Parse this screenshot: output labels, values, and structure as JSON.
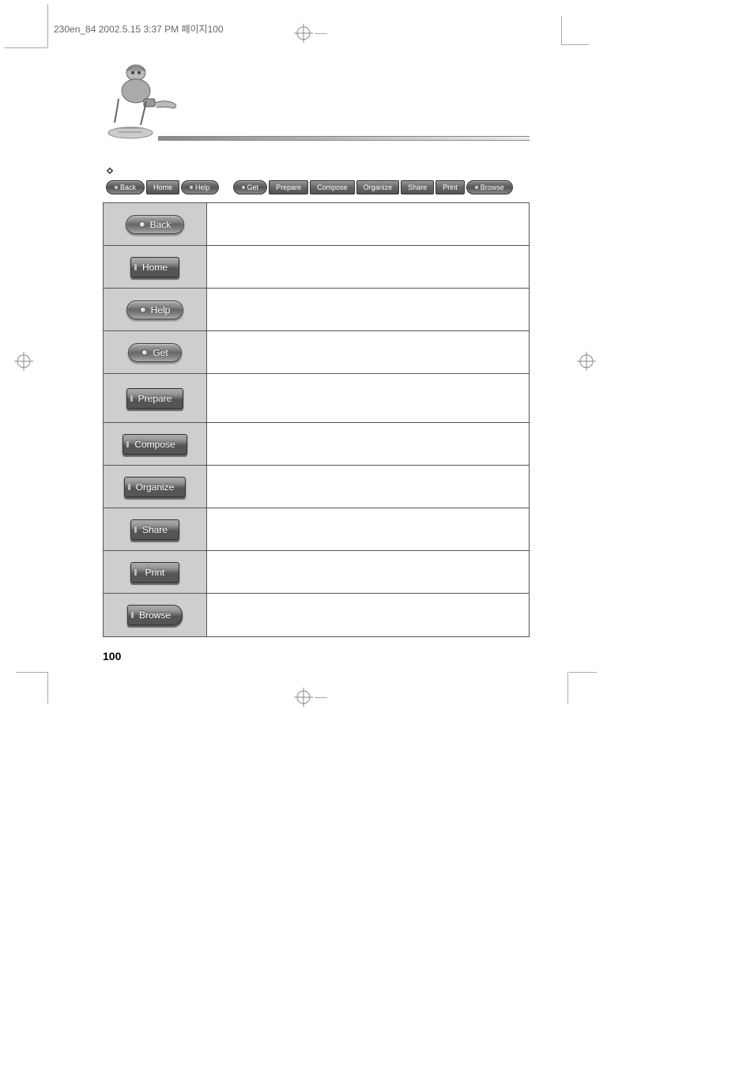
{
  "document": {
    "header_text": "230en_84  2002.5.15 3:37 PM  페이지100",
    "page_number": "100"
  },
  "toolbar": {
    "items": [
      "Back",
      "Home",
      "Help",
      "Get",
      "Prepare",
      "Compose",
      "Organize",
      "Share",
      "Print",
      "Browse"
    ]
  },
  "table": {
    "rows": [
      {
        "label": "Back",
        "style": "pill"
      },
      {
        "label": "Home",
        "style": "tab"
      },
      {
        "label": "Help",
        "style": "pill"
      },
      {
        "label": "Get",
        "style": "pill"
      },
      {
        "label": "Prepare",
        "style": "tab"
      },
      {
        "label": "Compose",
        "style": "tab"
      },
      {
        "label": "Organize",
        "style": "tab"
      },
      {
        "label": "Share",
        "style": "tab"
      },
      {
        "label": "Print",
        "style": "tab"
      },
      {
        "label": "Browse",
        "style": "pill-tab"
      }
    ]
  }
}
